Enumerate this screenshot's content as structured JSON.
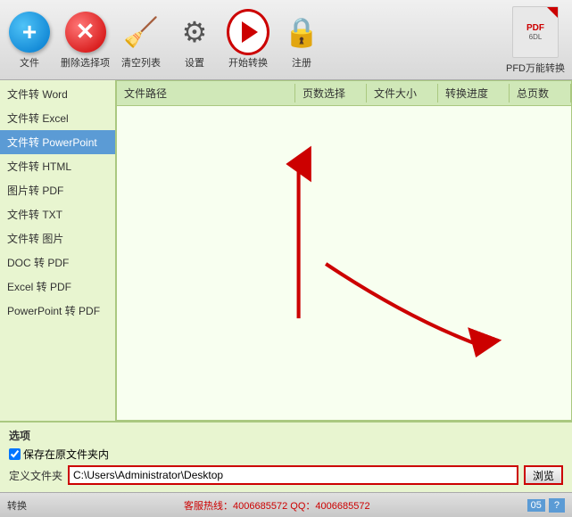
{
  "app": {
    "title": "PFD万能转换"
  },
  "toolbar": {
    "add_label": "文件",
    "delete_label": "删除选择项",
    "clear_label": "清空列表",
    "settings_label": "设置",
    "start_label": "开始转换",
    "register_label": "注册",
    "pdf_logo_text": "PFD万能转换"
  },
  "sidebar": {
    "items": [
      {
        "label": "文件转 Word",
        "active": false
      },
      {
        "label": "文件转 Excel",
        "active": false
      },
      {
        "label": "文件转 PowerPoint",
        "active": true
      },
      {
        "label": "文件转 HTML",
        "active": false
      },
      {
        "label": "图片转 PDF",
        "active": false
      },
      {
        "label": "文件转 TXT",
        "active": false
      },
      {
        "label": "文件转 图片",
        "active": false
      },
      {
        "label": "DOC 转 PDF",
        "active": false
      },
      {
        "label": "Excel 转 PDF",
        "active": false
      },
      {
        "label": "PowerPoint 转 PDF",
        "active": false
      }
    ]
  },
  "table": {
    "headers": [
      "文件路径",
      "页数选择",
      "文件大小",
      "转换进度",
      "总页数"
    ],
    "rows": []
  },
  "bottom": {
    "section_label": "选项",
    "save_option_label": "保存在原文件夹内",
    "path_label": "定义文件夹",
    "path_value": "C:\\Users\\Administrator\\Desktop",
    "browse_label": "浏览"
  },
  "statusbar": {
    "convert_label": "转换",
    "hotline": "客服热线：4006685572 QQ：4006685572",
    "page_num": "05"
  }
}
